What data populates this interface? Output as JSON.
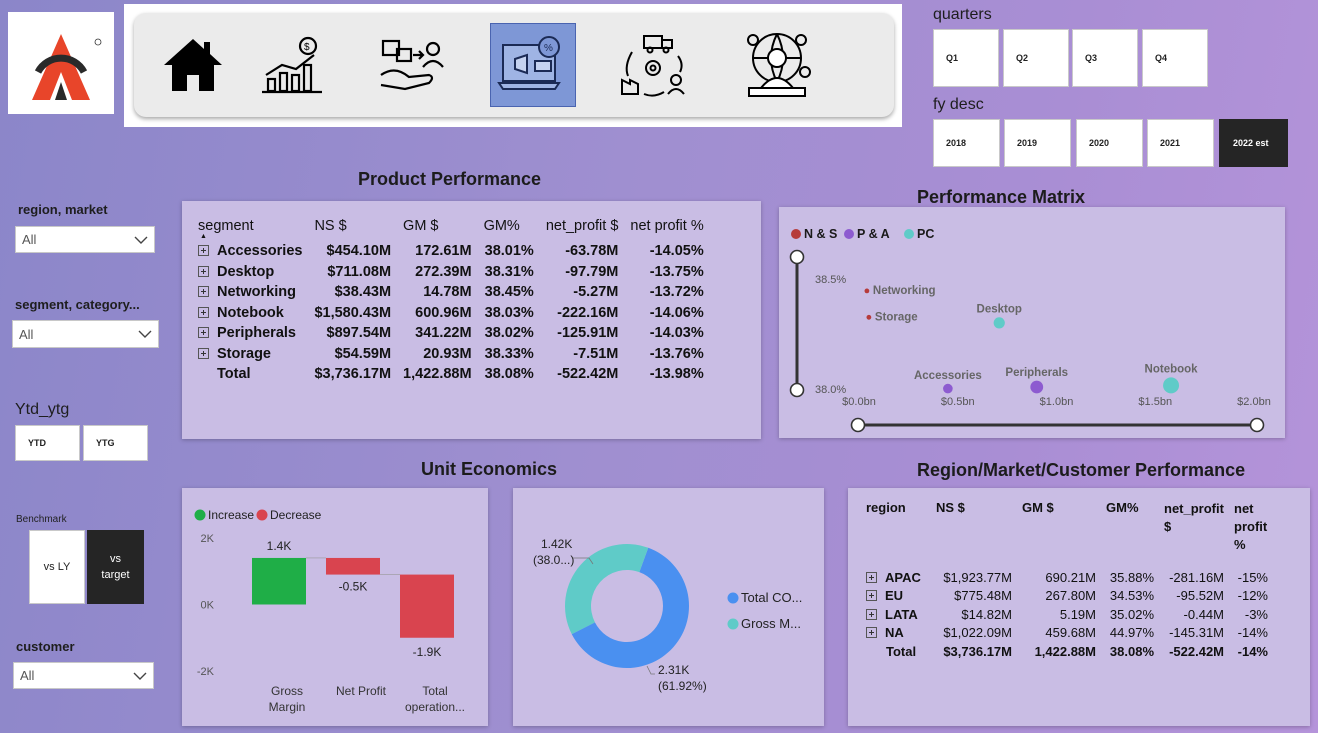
{
  "slicers": {
    "quarters": {
      "label": "quarters",
      "options": [
        "Q1",
        "Q2",
        "Q3",
        "Q4"
      ]
    },
    "fy_desc": {
      "label": "fy desc",
      "options": [
        "2018",
        "2019",
        "2020",
        "2021",
        "2022 est"
      ],
      "selected": "2022 est"
    },
    "region_market": {
      "label": "region, market",
      "value": "All"
    },
    "segment_category": {
      "label": "segment, category...",
      "value": "All"
    },
    "ytd_ytg": {
      "label": "Ytd_ytg",
      "options": [
        "YTD",
        "YTG"
      ]
    },
    "benchmark": {
      "label": "Benchmark",
      "options": [
        "vs LY",
        "vs target"
      ],
      "selected": "vs target"
    },
    "customer": {
      "label": "customer",
      "value": "All"
    }
  },
  "nav": {
    "icons": [
      "home-icon",
      "finance-chart-icon",
      "sales-handshake-icon",
      "marketing-laptop-icon",
      "supply-chain-icon",
      "executive-globe-icon"
    ],
    "active": "marketing-laptop-icon"
  },
  "product_performance": {
    "title": "Product Performance",
    "columns": [
      "segment",
      "NS $",
      "GM $",
      "GM%",
      "net_profit $",
      "net profit %"
    ],
    "rows": [
      [
        "Accessories",
        "$454.10M",
        "172.61M",
        "38.01%",
        "-63.78M",
        "-14.05%"
      ],
      [
        "Desktop",
        "$711.08M",
        "272.39M",
        "38.31%",
        "-97.79M",
        "-13.75%"
      ],
      [
        "Networking",
        "$38.43M",
        "14.78M",
        "38.45%",
        "-5.27M",
        "-13.72%"
      ],
      [
        "Notebook",
        "$1,580.43M",
        "600.96M",
        "38.03%",
        "-222.16M",
        "-14.06%"
      ],
      [
        "Peripherals",
        "$897.54M",
        "341.22M",
        "38.02%",
        "-125.91M",
        "-14.03%"
      ],
      [
        "Storage",
        "$54.59M",
        "20.93M",
        "38.33%",
        "-7.51M",
        "-13.76%"
      ]
    ],
    "total": [
      "Total",
      "$3,736.17M",
      "1,422.88M",
      "38.08%",
      "-522.42M",
      "-13.98%"
    ]
  },
  "performance_matrix": {
    "title": "Performance Matrix",
    "chart_data": {
      "type": "scatter",
      "legend": [
        {
          "name": "N & S",
          "color": "#b63b3b"
        },
        {
          "name": "P & A",
          "color": "#8d5bd0"
        },
        {
          "name": "PC",
          "color": "#5fcbc8"
        }
      ],
      "x_ticks": [
        "$0.0bn",
        "$0.5bn",
        "$1.0bn",
        "$1.5bn",
        "$2.0bn"
      ],
      "y_ticks": [
        "38.5%",
        "38.0%"
      ],
      "xlim": [
        0,
        2.0
      ],
      "ylim": [
        38.0,
        38.5
      ],
      "points": [
        {
          "label": "Networking",
          "group": "N & S",
          "x": 0.04,
          "y": 38.45,
          "size": 3
        },
        {
          "label": "Storage",
          "group": "N & S",
          "x": 0.05,
          "y": 38.33,
          "size": 3
        },
        {
          "label": "Desktop",
          "group": "PC",
          "x": 0.71,
          "y": 38.31,
          "size": 7
        },
        {
          "label": "Accessories",
          "group": "P & A",
          "x": 0.45,
          "y": 38.01,
          "size": 6
        },
        {
          "label": "Peripherals",
          "group": "P & A",
          "x": 0.9,
          "y": 38.02,
          "size": 8
        },
        {
          "label": "Notebook",
          "group": "PC",
          "x": 1.58,
          "y": 38.03,
          "size": 10
        }
      ]
    }
  },
  "unit_economics": {
    "title": "Unit Economics",
    "waterfall": {
      "type": "bar",
      "legend": [
        {
          "name": "Increase",
          "color": "#1fae47"
        },
        {
          "name": "Decrease",
          "color": "#d9444f"
        }
      ],
      "y_ticks": [
        "2K",
        "0K",
        "-2K"
      ],
      "ylim": [
        -2,
        2
      ],
      "categories": [
        "Gross Margin",
        "Net Profit",
        "Total operation..."
      ],
      "bars": [
        {
          "start": 0,
          "end": 1.4,
          "label": "1.4K",
          "color": "#1fae47"
        },
        {
          "start": 1.4,
          "end": 0.9,
          "label": "-0.5K",
          "color": "#d9444f"
        },
        {
          "start": 0.9,
          "end": -1.0,
          "label": "-1.9K",
          "color": "#d9444f"
        }
      ]
    },
    "donut": {
      "type": "pie",
      "slices": [
        {
          "name": "Total CO...",
          "value": 2.31,
          "pct": "(61.92%)",
          "label": "2.31K",
          "color": "#4a90f0"
        },
        {
          "name": "Gross M...",
          "value": 1.42,
          "pct": "(38.0...)",
          "label": "1.42K",
          "color": "#5fcbc8"
        }
      ]
    }
  },
  "region_performance": {
    "title": "Region/Market/Customer Performance",
    "columns": [
      "region",
      "NS $",
      "GM $",
      "GM%",
      "net_profit $",
      "net profit %"
    ],
    "rows": [
      [
        "APAC",
        "$1,923.77M",
        "690.21M",
        "35.88%",
        "-281.16M",
        "-15%"
      ],
      [
        "EU",
        "$775.48M",
        "267.80M",
        "34.53%",
        "-95.52M",
        "-12%"
      ],
      [
        "LATA",
        "$14.82M",
        "5.19M",
        "35.02%",
        "-0.44M",
        "-3%"
      ],
      [
        "NA",
        "$1,022.09M",
        "459.68M",
        "44.97%",
        "-145.31M",
        "-14%"
      ]
    ],
    "total": [
      "Total",
      "$3,736.17M",
      "1,422.88M",
      "38.08%",
      "-522.42M",
      "-14%"
    ]
  }
}
